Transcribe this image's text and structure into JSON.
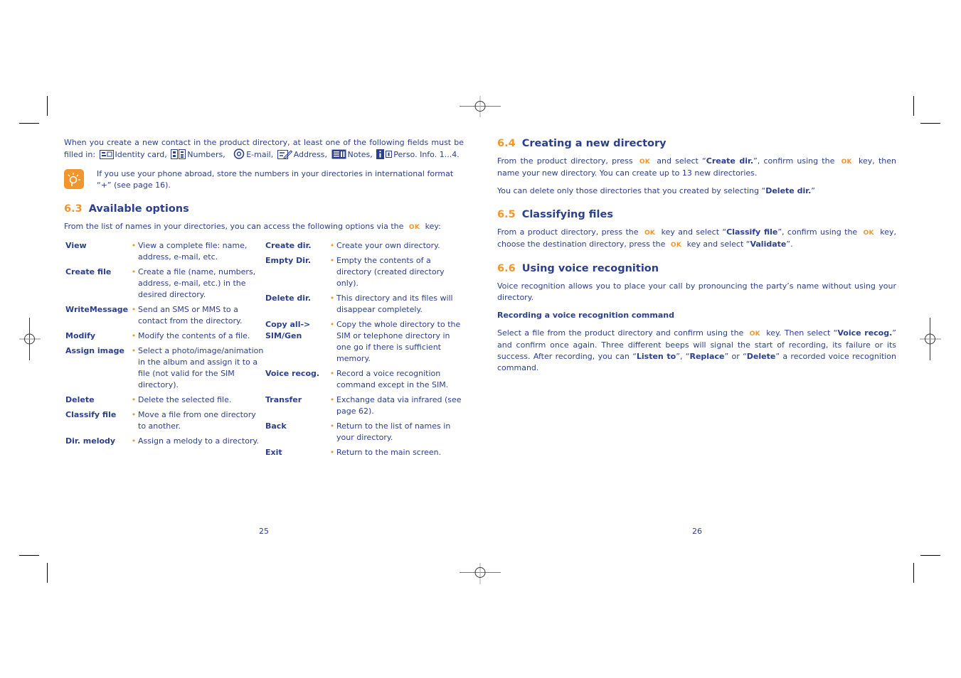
{
  "left_page": {
    "intro": {
      "text_before": "When you create a new contact in the product directory, at least one of the following fields must be filled in:",
      "fields": [
        {
          "icon": "identity-card-icon",
          "label": "Identity card,"
        },
        {
          "icon": "numbers-icon",
          "label": "Numbers,"
        },
        {
          "icon": "email-at-icon",
          "label": "E-mail,"
        },
        {
          "icon": "address-icon",
          "label": "Address,"
        },
        {
          "icon": "notes-icon",
          "label": "Notes,"
        },
        {
          "icon": "perso-info-icon",
          "label": "Perso. Info. 1...4."
        }
      ]
    },
    "tip": {
      "icon": "lightbulb-tip-icon",
      "text": "If you use your phone abroad, store the numbers in your directories in international format “+” (see page 16)."
    },
    "section": {
      "number": "6.3",
      "title": "Available options",
      "intro_before": "From the list of names in your directories, you can access the following options via the",
      "ok_key": "OK",
      "intro_after": "key:"
    },
    "options_col1": [
      {
        "name": "View",
        "desc": "View a complete file: name, address, e-mail, etc."
      },
      {
        "name": "Create file",
        "desc": "Create a file (name, numbers, address, e-mail, etc.) in the desired directory."
      },
      {
        "name": "WriteMessage",
        "desc": "Send an SMS or MMS to a contact from the directory."
      },
      {
        "name": "Modify",
        "desc": "Modify the contents of a file."
      },
      {
        "name": "Assign image",
        "desc": "Select a photo/image/animation in the album and assign it to a file (not valid for the SIM directory)."
      },
      {
        "name": "Delete",
        "desc": "Delete the selected file."
      },
      {
        "name": "Classify file",
        "desc": "Move a file from one directory to another."
      },
      {
        "name": "Dir. melody",
        "desc": "Assign a melody to a directory."
      }
    ],
    "options_col2": [
      {
        "name": "Create dir.",
        "desc": "Create your own directory."
      },
      {
        "name": "Empty Dir.",
        "desc": "Empty the contents of a directory (created directory only)."
      },
      {
        "name": "Delete dir.",
        "desc": "This directory and its files will disappear completely."
      },
      {
        "name": "Copy all-> SIM/Gen",
        "desc": "Copy the whole directory to the SIM or telephone directory in one go if there is sufficient memory."
      },
      {
        "name": "Voice recog.",
        "desc": "Record a voice recognition command except in the SIM."
      },
      {
        "name": "Transfer",
        "desc": "Exchange data via infrared (see page 62)."
      },
      {
        "name": "Back",
        "desc": "Return to the list of names in your directory."
      },
      {
        "name": "Exit",
        "desc": "Return to the main screen."
      }
    ],
    "bullet": "•",
    "page_number": "25"
  },
  "right_page": {
    "s64": {
      "number": "6.4",
      "title": "Creating a new directory",
      "p1": {
        "a": "From the product directory, press",
        "ok1": "OK",
        "b": "and select “",
        "bold1": "Create dir.",
        "c": "”, confirm using the",
        "ok2": "OK",
        "d": "key, then name your new directory. You can create up to 13 new directories."
      },
      "p2": {
        "a": "You can delete only those directories that you created by selecting “",
        "bold1": "Delete dir.",
        "b": "”"
      }
    },
    "s65": {
      "number": "6.5",
      "title": "Classifying files",
      "p1": {
        "a": "From a product directory, press the",
        "ok1": "OK",
        "b": "key and select “",
        "bold1": "Classify file",
        "c": "”, confirm using the",
        "ok2": "OK",
        "d": "key, choose the destination directory, press the",
        "ok3": "OK",
        "e": "key and select “",
        "bold2": "Validate",
        "f": "”."
      }
    },
    "s66": {
      "number": "6.6",
      "title": "Using voice recognition",
      "p1": "Voice recognition allows you to place your call by pronouncing the party’s name without using your directory.",
      "subheading": "Recording a voice recognition command",
      "p2": {
        "a": "Select a file from the product directory and confirm using the",
        "ok1": "OK",
        "b": "key. Then select “",
        "bold1": "Voice recog.",
        "c": "” and confirm once again. Three different beeps will signal the start of recording, its failure or its success. After recording, you can “",
        "bold2": "Listen to",
        "d": "”, “",
        "bold3": "Replace",
        "e": "” or “",
        "bold4": "Delete",
        "f": "” a recorded voice recognition command."
      }
    },
    "page_number": "26"
  },
  "colors": {
    "text": "#2b3f8c",
    "accent": "#f0962d"
  }
}
